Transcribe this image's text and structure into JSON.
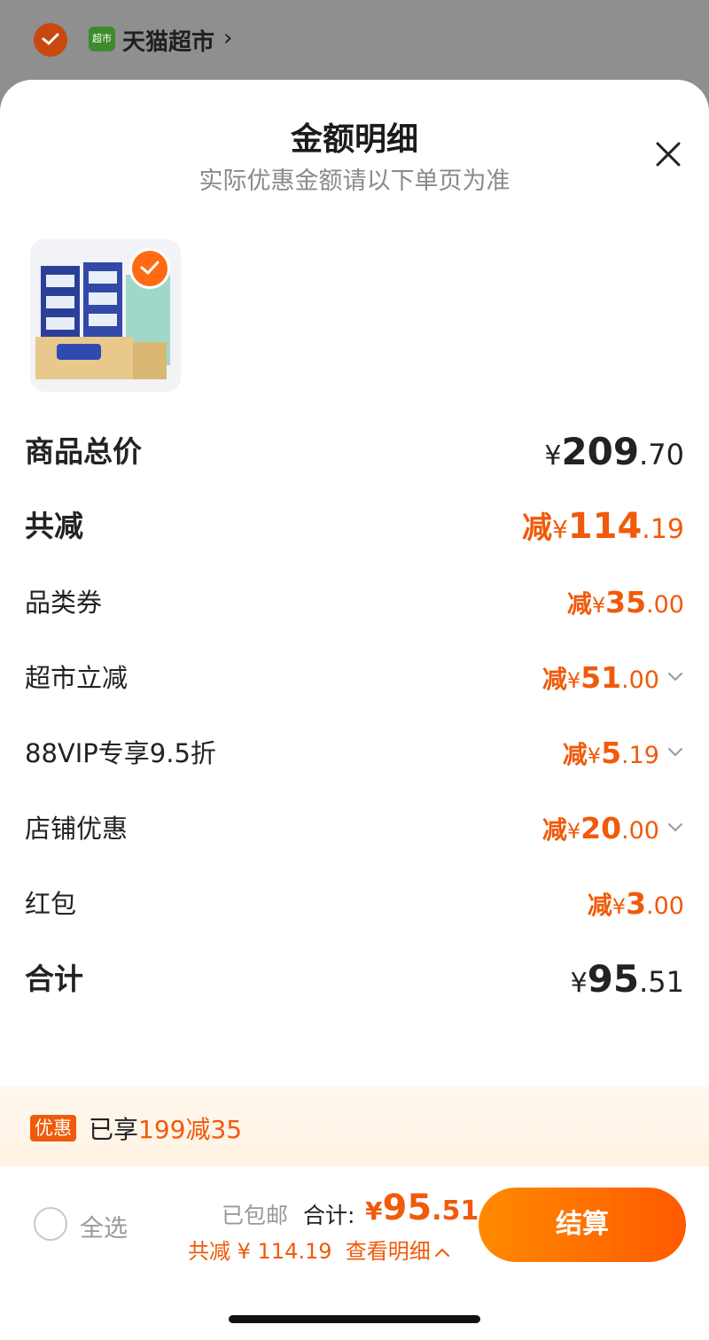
{
  "store": {
    "name": "天猫超市",
    "logo_text": "超市"
  },
  "sheet": {
    "title": "金额明细",
    "subtitle": "实际优惠金额请以下单页为准"
  },
  "rows": {
    "subtotal": {
      "label": "商品总价",
      "currency": "¥",
      "int": "209",
      "dec": ".70"
    },
    "total_off": {
      "label": "共减",
      "prefix": "减",
      "currency": "¥",
      "int": "114",
      "dec": ".19"
    },
    "category_coupon": {
      "label": "品类券",
      "prefix": "减",
      "currency": "¥",
      "int": "35",
      "dec": ".00"
    },
    "market_discount": {
      "label": "超市立减",
      "prefix": "减",
      "currency": "¥",
      "int": "51",
      "dec": ".00"
    },
    "vip": {
      "label": "88VIP专享9.5折",
      "prefix": "减",
      "currency": "¥",
      "int": "5",
      "dec": ".19"
    },
    "store_discount": {
      "label": "店铺优惠",
      "prefix": "减",
      "currency": "¥",
      "int": "20",
      "dec": ".00"
    },
    "red_packet": {
      "label": "红包",
      "prefix": "减",
      "currency": "¥",
      "int": "3",
      "dec": ".00"
    },
    "total": {
      "label": "合计",
      "currency": "¥",
      "int": "95",
      "dec": ".51"
    }
  },
  "promo": {
    "tag": "优惠",
    "text": "已享",
    "highlight": "199减35"
  },
  "bottom": {
    "select_all": "全选",
    "shipping": "已包邮",
    "total_label": "合计:",
    "currency": "¥",
    "total_int": "95",
    "total_dec": ".51",
    "saved_label": "共减 ¥ 114.19",
    "details_link": "查看明细",
    "checkout": "结算"
  },
  "colors": {
    "accent": "#f05a0a",
    "checkout_start": "#ff8a00",
    "checkout_end": "#ff5a00"
  }
}
